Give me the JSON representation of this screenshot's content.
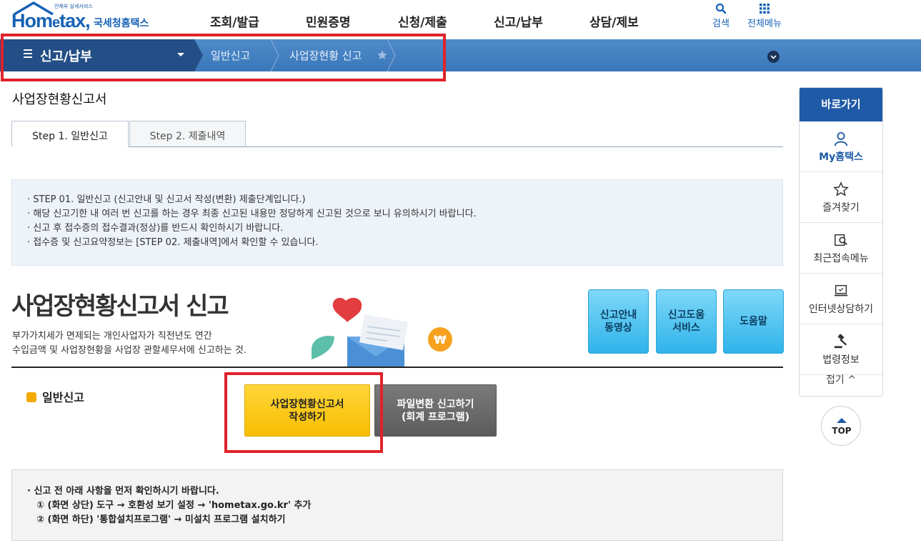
{
  "header": {
    "logo_tagline": "언제부 살세서비스",
    "logo_brand_a": "Hom",
    "logo_brand_e": "e",
    "logo_brand_b": "tax,",
    "logo_korean": "국세청홈택스",
    "nav": [
      "조회/발급",
      "민원증명",
      "신청/제출",
      "신고/납부",
      "상담/제보"
    ],
    "search_label": "검색",
    "allmenu_label": "전체메뉴"
  },
  "locbar": {
    "main_label": "신고/납부",
    "crumb1": "일반신고",
    "crumb2": "사업장현황 신고"
  },
  "page": {
    "title": "사업장현황신고서",
    "tabs": [
      "Step 1. 일반신고",
      "Step 2. 제출내역"
    ],
    "notice1": [
      "STEP 01. 일반신고 (신고안내 및 신고서 작성(변환) 제출단계입니다.)",
      "해당 신고기한 내 여러 번 신고를 하는 경우 최종 신고된 내용만 정당하게 신고된 것으로 보니 유의하시기 바랍니다.",
      "신고 후 접수증의 접수결과(정상)를 반드시 확인하시기 바랍니다.",
      "접수증 및 신고요약정보는 [STEP 02. 제출내역]에서 확인할 수 있습니다."
    ],
    "big_title": "사업장현황신고서 신고",
    "desc_line1": "부가가치세가 면제되는 개인사업자가 직전년도 연간",
    "desc_line2": "수입금액 및 사업장현황을 사업장 관할세무서에 신고하는 것.",
    "sq_buttons": [
      "신고안내\n동영상",
      "신고도움\n서비스",
      "도움말"
    ],
    "section_label": "일반신고",
    "btn_write_l1": "사업장현황신고서",
    "btn_write_l2": "작성하기",
    "btn_file_l1": "파일변환 신고하기",
    "btn_file_l2": "(회계 프로그램)",
    "notice2_head": "신고 전 아래 사항을 먼저 확인하시기 바랍니다.",
    "notice2_l1": "① (화면 상단)  도구 → 호환성 보기 설정 →  'hometax.go.kr' 추가",
    "notice2_l2": "② (화면 하단)  '통합설치프로그램'  →  미설치 프로그램 설치하기"
  },
  "quick": {
    "head": "바로가기",
    "items": [
      "My홈택스",
      "즐겨찾기",
      "최근접속메뉴",
      "인터넷상담하기",
      "법령정보"
    ],
    "fold": "접기 ^",
    "top": "TOP"
  },
  "colors": {
    "brand": "#1762b5",
    "locbar_dark": "#234e86",
    "highlight_red": "#e0232b",
    "write_button": "#ffc400",
    "file_button": "#6b6b6b"
  }
}
